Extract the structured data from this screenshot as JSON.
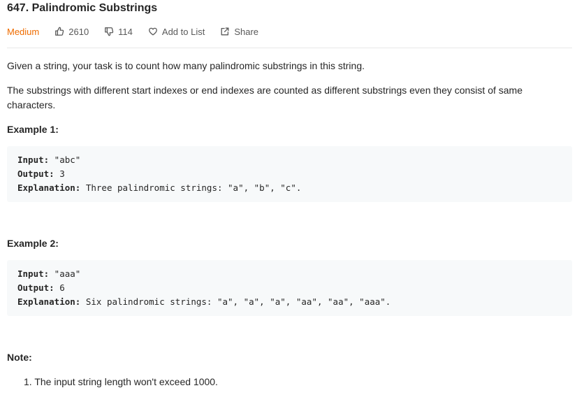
{
  "problem": {
    "title": "647. Palindromic Substrings",
    "difficulty": "Medium",
    "likes": "2610",
    "dislikes": "114",
    "add_to_list_label": "Add to List",
    "share_label": "Share",
    "accent_color": "#ef6c00"
  },
  "description": {
    "paragraph_1": "Given a string, your task is to count how many palindromic substrings in this string.",
    "paragraph_2": "The substrings with different start indexes or end indexes are counted as different substrings even they consist of same characters."
  },
  "examples": [
    {
      "heading": "Example 1:",
      "input_label": "Input:",
      "input_value": " \"abc\"",
      "output_label": "Output:",
      "output_value": " 3",
      "explanation_label": "Explanation:",
      "explanation_value": " Three palindromic strings: \"a\", \"b\", \"c\"."
    },
    {
      "heading": "Example 2:",
      "input_label": "Input:",
      "input_value": " \"aaa\"",
      "output_label": "Output:",
      "output_value": " 6",
      "explanation_label": "Explanation:",
      "explanation_value": " Six palindromic strings: \"a\", \"a\", \"a\", \"aa\", \"aa\", \"aaa\"."
    }
  ],
  "note": {
    "heading": "Note:",
    "items": [
      {
        "number": "1.",
        "text": "The input string length won't exceed 1000."
      }
    ]
  },
  "icons": {
    "like": "thumbs-up-icon",
    "dislike": "thumbs-down-icon",
    "add_to_list": "heart-icon",
    "share": "share-icon"
  }
}
